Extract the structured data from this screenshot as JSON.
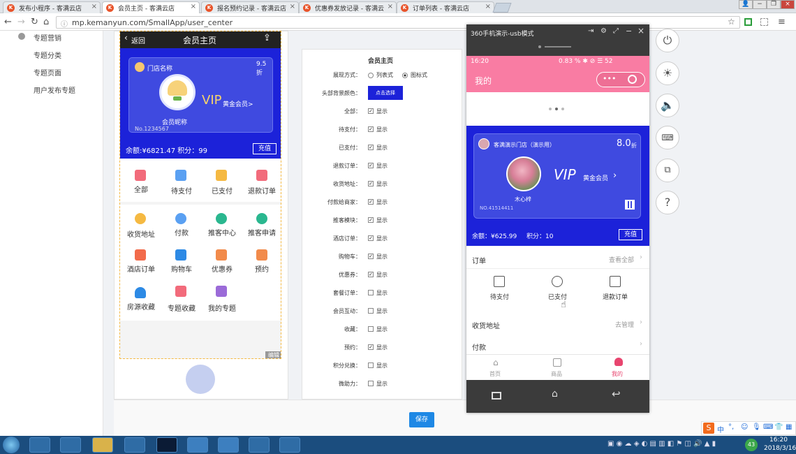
{
  "browser": {
    "tabs": [
      {
        "label": "发布小程序 - 客满云店",
        "active": false
      },
      {
        "label": "会员主页 - 客满云店",
        "active": true
      },
      {
        "label": "报名预约记录 - 客满云店",
        "active": false
      },
      {
        "label": "优惠券发放记录 - 客满云",
        "active": false
      },
      {
        "label": "订单列表 - 客满云店",
        "active": false
      }
    ],
    "url": "mp.kemanyun.com/SmallApp/user_center"
  },
  "sidebar": {
    "section": "专题营销",
    "items": [
      "专题分类",
      "专题页面",
      "用户发布专题"
    ]
  },
  "preview": {
    "back": "返回",
    "title": "会员主页",
    "store_name": "门店名称",
    "discount": "9.5折",
    "vip": "VIP",
    "level": "黄金会员>",
    "nickname": "会员昵称",
    "number": "No.1234567",
    "balance": "余额:¥6821.47 积分：99",
    "recharge": "充值",
    "orders": [
      "全部",
      "待支付",
      "已支付",
      "退款订单"
    ],
    "features": [
      "收货地址",
      "付款",
      "推客中心",
      "推客申请",
      "酒店订单",
      "购物车",
      "优惠券",
      "预约",
      "房源收藏",
      "专题收藏",
      "我的专题"
    ],
    "edit": "编辑"
  },
  "form": {
    "title": "会员主页",
    "display_label": "展现方式：",
    "display_options": [
      "列表式",
      "图标式"
    ],
    "bg_label": "头部背景颜色：",
    "bg_button": "点击选择",
    "show_text": "显示",
    "rows": [
      {
        "label": "全部：",
        "checked": true
      },
      {
        "label": "待支付：",
        "checked": true
      },
      {
        "label": "已支付：",
        "checked": true
      },
      {
        "label": "退款订单：",
        "checked": true
      },
      {
        "label": "收货地址：",
        "checked": true
      },
      {
        "label": "付款给商家：",
        "checked": true
      },
      {
        "label": "推客模块：",
        "checked": true
      },
      {
        "label": "酒店订单：",
        "checked": true
      },
      {
        "label": "购物车：",
        "checked": true
      },
      {
        "label": "优惠券：",
        "checked": true
      },
      {
        "label": "套餐订单：",
        "checked": false
      },
      {
        "label": "会员互动：",
        "checked": false
      },
      {
        "label": "收藏：",
        "checked": false
      },
      {
        "label": "预约：",
        "checked": true
      },
      {
        "label": "积分兑换：",
        "checked": false
      },
      {
        "label": "微助力：",
        "checked": false
      }
    ],
    "save": "保存"
  },
  "emulator": {
    "title": "360手机演示-usb模式",
    "status_time": "16:20",
    "status_right": "0.83 % ✱ ⊘ ☰ 52",
    "header": "我的",
    "store": "客满演示门店（演示用）",
    "discount": "8.0",
    "discount_unit": "折",
    "vip": "VIP",
    "level": "黄金会员",
    "nickname": "木心梓",
    "number": "NO.41514411",
    "balance": "余额：¥625.99",
    "points": "积分：10",
    "recharge": "充值",
    "orders_label": "订单",
    "view_all": "查看全部",
    "order_items": [
      "待支付",
      "已支付",
      "退款订单"
    ],
    "address": "收货地址",
    "manage": "去管理",
    "payment": "付款",
    "tabs": [
      "首页",
      "商品",
      "我的"
    ]
  },
  "tray": {
    "time": "16:20",
    "date": "2018/3/16",
    "ime": "中"
  },
  "colors": {
    "vip_blue": "#1c22d9",
    "pink": "#f97ca3",
    "save_blue": "#1e88e5"
  }
}
